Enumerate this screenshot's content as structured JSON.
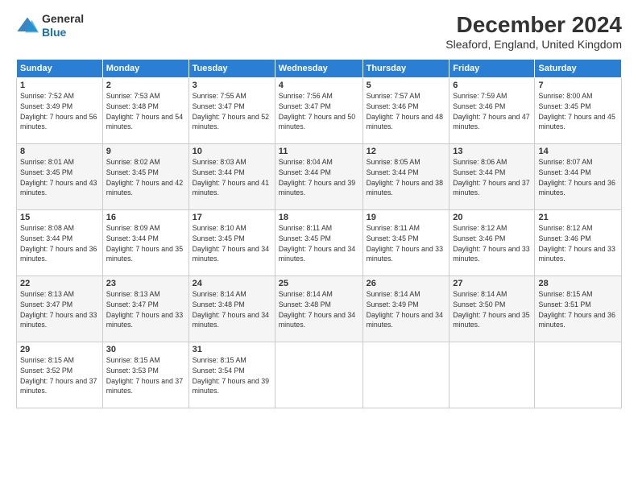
{
  "header": {
    "logo_line1": "General",
    "logo_line2": "Blue",
    "title": "December 2024",
    "subtitle": "Sleaford, England, United Kingdom"
  },
  "days_of_week": [
    "Sunday",
    "Monday",
    "Tuesday",
    "Wednesday",
    "Thursday",
    "Friday",
    "Saturday"
  ],
  "weeks": [
    [
      {
        "day": "1",
        "sunrise": "7:52 AM",
        "sunset": "3:49 PM",
        "daylight": "7 hours and 56 minutes."
      },
      {
        "day": "2",
        "sunrise": "7:53 AM",
        "sunset": "3:48 PM",
        "daylight": "7 hours and 54 minutes."
      },
      {
        "day": "3",
        "sunrise": "7:55 AM",
        "sunset": "3:47 PM",
        "daylight": "7 hours and 52 minutes."
      },
      {
        "day": "4",
        "sunrise": "7:56 AM",
        "sunset": "3:47 PM",
        "daylight": "7 hours and 50 minutes."
      },
      {
        "day": "5",
        "sunrise": "7:57 AM",
        "sunset": "3:46 PM",
        "daylight": "7 hours and 48 minutes."
      },
      {
        "day": "6",
        "sunrise": "7:59 AM",
        "sunset": "3:46 PM",
        "daylight": "7 hours and 47 minutes."
      },
      {
        "day": "7",
        "sunrise": "8:00 AM",
        "sunset": "3:45 PM",
        "daylight": "7 hours and 45 minutes."
      }
    ],
    [
      {
        "day": "8",
        "sunrise": "8:01 AM",
        "sunset": "3:45 PM",
        "daylight": "7 hours and 43 minutes."
      },
      {
        "day": "9",
        "sunrise": "8:02 AM",
        "sunset": "3:45 PM",
        "daylight": "7 hours and 42 minutes."
      },
      {
        "day": "10",
        "sunrise": "8:03 AM",
        "sunset": "3:44 PM",
        "daylight": "7 hours and 41 minutes."
      },
      {
        "day": "11",
        "sunrise": "8:04 AM",
        "sunset": "3:44 PM",
        "daylight": "7 hours and 39 minutes."
      },
      {
        "day": "12",
        "sunrise": "8:05 AM",
        "sunset": "3:44 PM",
        "daylight": "7 hours and 38 minutes."
      },
      {
        "day": "13",
        "sunrise": "8:06 AM",
        "sunset": "3:44 PM",
        "daylight": "7 hours and 37 minutes."
      },
      {
        "day": "14",
        "sunrise": "8:07 AM",
        "sunset": "3:44 PM",
        "daylight": "7 hours and 36 minutes."
      }
    ],
    [
      {
        "day": "15",
        "sunrise": "8:08 AM",
        "sunset": "3:44 PM",
        "daylight": "7 hours and 36 minutes."
      },
      {
        "day": "16",
        "sunrise": "8:09 AM",
        "sunset": "3:44 PM",
        "daylight": "7 hours and 35 minutes."
      },
      {
        "day": "17",
        "sunrise": "8:10 AM",
        "sunset": "3:45 PM",
        "daylight": "7 hours and 34 minutes."
      },
      {
        "day": "18",
        "sunrise": "8:11 AM",
        "sunset": "3:45 PM",
        "daylight": "7 hours and 34 minutes."
      },
      {
        "day": "19",
        "sunrise": "8:11 AM",
        "sunset": "3:45 PM",
        "daylight": "7 hours and 33 minutes."
      },
      {
        "day": "20",
        "sunrise": "8:12 AM",
        "sunset": "3:46 PM",
        "daylight": "7 hours and 33 minutes."
      },
      {
        "day": "21",
        "sunrise": "8:12 AM",
        "sunset": "3:46 PM",
        "daylight": "7 hours and 33 minutes."
      }
    ],
    [
      {
        "day": "22",
        "sunrise": "8:13 AM",
        "sunset": "3:47 PM",
        "daylight": "7 hours and 33 minutes."
      },
      {
        "day": "23",
        "sunrise": "8:13 AM",
        "sunset": "3:47 PM",
        "daylight": "7 hours and 33 minutes."
      },
      {
        "day": "24",
        "sunrise": "8:14 AM",
        "sunset": "3:48 PM",
        "daylight": "7 hours and 34 minutes."
      },
      {
        "day": "25",
        "sunrise": "8:14 AM",
        "sunset": "3:48 PM",
        "daylight": "7 hours and 34 minutes."
      },
      {
        "day": "26",
        "sunrise": "8:14 AM",
        "sunset": "3:49 PM",
        "daylight": "7 hours and 34 minutes."
      },
      {
        "day": "27",
        "sunrise": "8:14 AM",
        "sunset": "3:50 PM",
        "daylight": "7 hours and 35 minutes."
      },
      {
        "day": "28",
        "sunrise": "8:15 AM",
        "sunset": "3:51 PM",
        "daylight": "7 hours and 36 minutes."
      }
    ],
    [
      {
        "day": "29",
        "sunrise": "8:15 AM",
        "sunset": "3:52 PM",
        "daylight": "7 hours and 37 minutes."
      },
      {
        "day": "30",
        "sunrise": "8:15 AM",
        "sunset": "3:53 PM",
        "daylight": "7 hours and 37 minutes."
      },
      {
        "day": "31",
        "sunrise": "8:15 AM",
        "sunset": "3:54 PM",
        "daylight": "7 hours and 39 minutes."
      },
      null,
      null,
      null,
      null
    ]
  ]
}
